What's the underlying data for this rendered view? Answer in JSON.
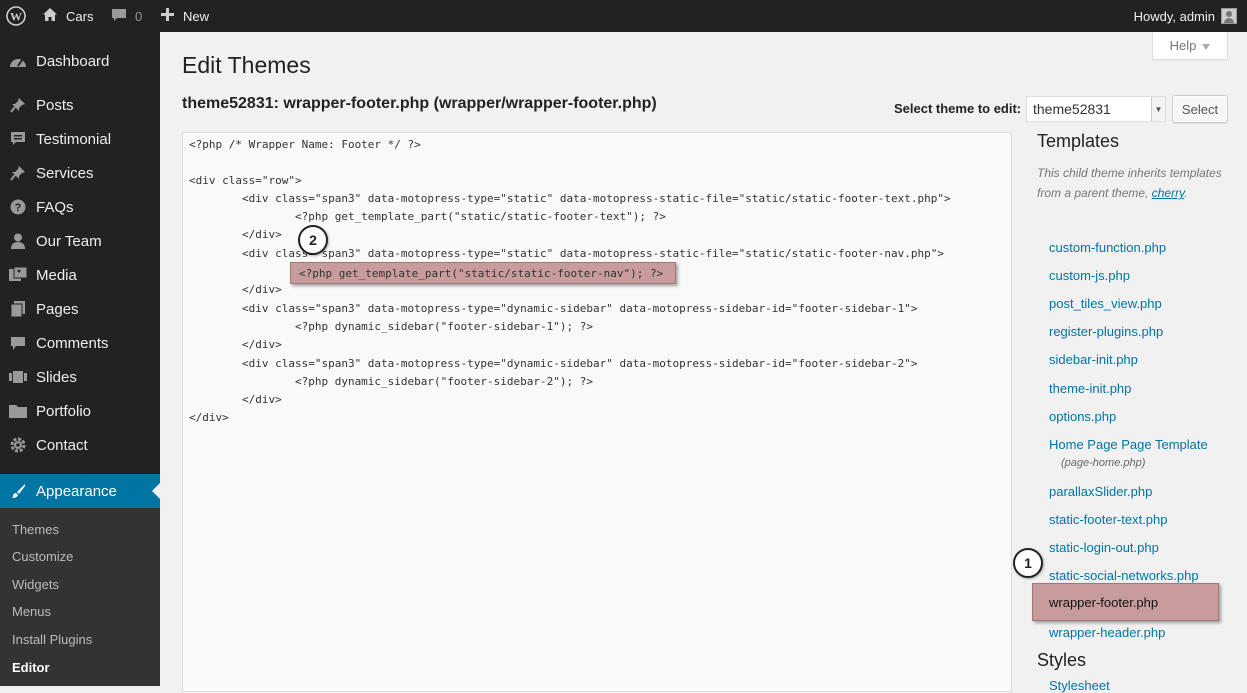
{
  "adminbar": {
    "site_name": "Cars",
    "comment_count": "0",
    "new_label": "New",
    "howdy": "Howdy, admin"
  },
  "sidebar": {
    "items": [
      {
        "label": "Dashboard",
        "icon": "dashboard-icon"
      },
      {
        "label": "Posts",
        "icon": "pin-icon"
      },
      {
        "label": "Testimonial",
        "icon": "comment-list-icon"
      },
      {
        "label": "Services",
        "icon": "pin-icon"
      },
      {
        "label": "FAQs",
        "icon": "question-icon"
      },
      {
        "label": "Our Team",
        "icon": "user-icon"
      },
      {
        "label": "Media",
        "icon": "media-icon"
      },
      {
        "label": "Pages",
        "icon": "pages-icon"
      },
      {
        "label": "Comments",
        "icon": "comment-icon"
      },
      {
        "label": "Slides",
        "icon": "slides-icon"
      },
      {
        "label": "Portfolio",
        "icon": "folder-icon"
      },
      {
        "label": "Contact",
        "icon": "gear-icon"
      },
      {
        "label": "Appearance",
        "icon": "brush-icon"
      }
    ],
    "submenu": [
      "Themes",
      "Customize",
      "Widgets",
      "Menus",
      "Install Plugins",
      "Editor"
    ]
  },
  "help_label": "Help",
  "page_title": "Edit Themes",
  "file_title": "theme52831: wrapper-footer.php (wrapper/wrapper-footer.php)",
  "select_label": "Select theme to edit:",
  "selected_theme": "theme52831",
  "select_button": "Select",
  "code": {
    "lines": [
      "<?php /* Wrapper Name: Footer */ ?>",
      "",
      "<div class=\"row\">",
      "        <div class=\"span3\" data-motopress-type=\"static\" data-motopress-static-file=\"static/static-footer-text.php\">",
      "                <?php get_template_part(\"static/static-footer-text\"); ?>",
      "        </div>",
      "        <div class=\"span3\" data-motopress-type=\"static\" data-motopress-static-file=\"static/static-footer-nav.php\">",
      "",
      "        </div>",
      "        <div class=\"span3\" data-motopress-type=\"dynamic-sidebar\" data-motopress-sidebar-id=\"footer-sidebar-1\">",
      "                <?php dynamic_sidebar(\"footer-sidebar-1\"); ?>",
      "        </div>",
      "        <div class=\"span3\" data-motopress-type=\"dynamic-sidebar\" data-motopress-sidebar-id=\"footer-sidebar-2\">",
      "                <?php dynamic_sidebar(\"footer-sidebar-2\"); ?>",
      "        </div>",
      "</div>"
    ],
    "highlighted_line": "<?php get_template_part(\"static/static-footer-nav\"); ?>"
  },
  "callouts": {
    "one": "1",
    "two": "2"
  },
  "templates": {
    "heading": "Templates",
    "note_text": "This child theme inherits templates from a parent theme, ",
    "parent_link": "cherry",
    "note_end": ".",
    "files": [
      "custom-function.php",
      "custom-js.php",
      "post_tiles_view.php",
      "register-plugins.php",
      "sidebar-init.php",
      "theme-init.php",
      "options.php",
      "Home Page Page Template",
      "parallaxSlider.php",
      "static-footer-text.php",
      "static-login-out.php",
      "static-social-networks.php",
      "wrapper-footer.php",
      "wrapper-header.php"
    ],
    "home_sub": "(page-home.php)"
  },
  "styles": {
    "heading": "Styles",
    "first": "Stylesheet"
  },
  "colors": {
    "accent": "#0074a2",
    "highlight": "#c89c9c"
  }
}
